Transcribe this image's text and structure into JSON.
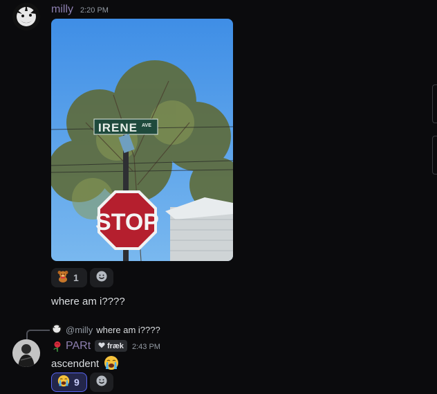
{
  "message1": {
    "username": "milly",
    "username_color": "#8d7fb0",
    "timestamp": "2:20 PM",
    "reaction": {
      "emoji": "teddy-bear",
      "count": "1"
    },
    "text": "where am i????"
  },
  "message2": {
    "reply": {
      "mention": "@milly",
      "text": "where am i????"
    },
    "username": "PARt",
    "username_color": "#8d7fb0",
    "tag": "fræk",
    "timestamp": "2:43 PM",
    "text": "ascendent",
    "reaction": {
      "emoji": "crying-face",
      "count": "9"
    }
  }
}
